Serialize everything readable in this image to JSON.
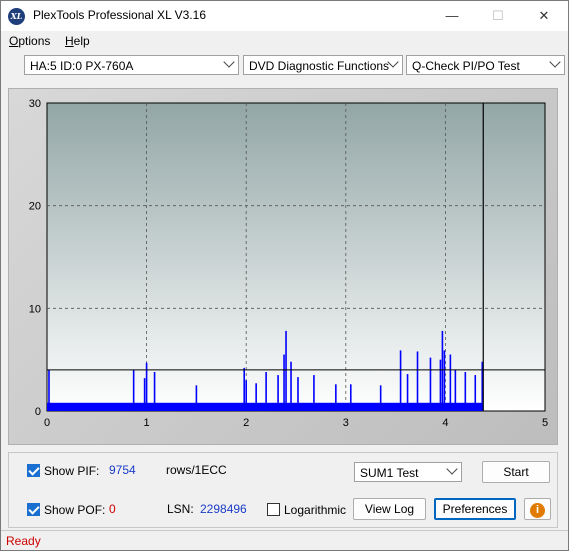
{
  "window": {
    "title": "PlexTools Professional XL V3.16",
    "app_icon_text": "XL",
    "minimize_glyph": "—",
    "maximize_glyph": "☐",
    "close_glyph": "✕"
  },
  "menu": {
    "items": [
      {
        "label": "Options",
        "accel": "O"
      },
      {
        "label": "Help",
        "accel": "H"
      }
    ]
  },
  "toolbar": {
    "drive": "HA:5 ID:0  PX-760A",
    "function": "DVD Diagnostic Functions",
    "test": "Q-Check PI/PO Test"
  },
  "chart_data": {
    "type": "bar",
    "x_ticks": [
      "0",
      "1",
      "2",
      "3",
      "4",
      "5"
    ],
    "y_ticks": [
      "0",
      "10",
      "20",
      "30"
    ],
    "xlim": [
      0,
      5
    ],
    "ylim": [
      0,
      30
    ],
    "grid": true,
    "threshold_line": 4,
    "scan_end": 4.38,
    "series_color": "#0000ff",
    "spikes": [
      {
        "x": 0.02,
        "y": 4
      },
      {
        "x": 0.87,
        "y": 4
      },
      {
        "x": 0.98,
        "y": 3.2
      },
      {
        "x": 1.0,
        "y": 4.7
      },
      {
        "x": 1.08,
        "y": 3.8
      },
      {
        "x": 1.5,
        "y": 2.5
      },
      {
        "x": 1.98,
        "y": 4.2
      },
      {
        "x": 2.0,
        "y": 3.0
      },
      {
        "x": 2.1,
        "y": 2.7
      },
      {
        "x": 2.2,
        "y": 3.8
      },
      {
        "x": 2.32,
        "y": 3.5
      },
      {
        "x": 2.38,
        "y": 5.5
      },
      {
        "x": 2.4,
        "y": 7.8
      },
      {
        "x": 2.45,
        "y": 4.8
      },
      {
        "x": 2.52,
        "y": 3.3
      },
      {
        "x": 2.68,
        "y": 3.5
      },
      {
        "x": 2.9,
        "y": 2.6
      },
      {
        "x": 3.05,
        "y": 2.6
      },
      {
        "x": 3.35,
        "y": 2.5
      },
      {
        "x": 3.55,
        "y": 5.9
      },
      {
        "x": 3.62,
        "y": 3.6
      },
      {
        "x": 3.72,
        "y": 5.8
      },
      {
        "x": 3.85,
        "y": 5.2
      },
      {
        "x": 3.95,
        "y": 5.0
      },
      {
        "x": 3.97,
        "y": 7.8
      },
      {
        "x": 3.99,
        "y": 5.9
      },
      {
        "x": 4.05,
        "y": 5.5
      },
      {
        "x": 4.1,
        "y": 4.0
      },
      {
        "x": 4.2,
        "y": 3.8
      },
      {
        "x": 4.3,
        "y": 3.5
      },
      {
        "x": 4.37,
        "y": 4.8
      }
    ]
  },
  "controls": {
    "show_pif_label": "Show PIF:",
    "pif_value": "9754",
    "pif_unit": "rows/1ECC",
    "show_pof_label": "Show POF:",
    "pof_value": "0",
    "lsn_label": "LSN:",
    "lsn_value": "2298496",
    "logarithmic_label": "Logarithmic",
    "sum_select": "SUM1 Test",
    "start_label": "Start",
    "view_log_label": "View Log",
    "preferences_label": "Preferences",
    "info_glyph": "i",
    "pif_color": "#1a3cc8",
    "pof_color": "#cc0000",
    "lsn_color": "#1a3cc8"
  },
  "status": {
    "text": "Ready"
  }
}
